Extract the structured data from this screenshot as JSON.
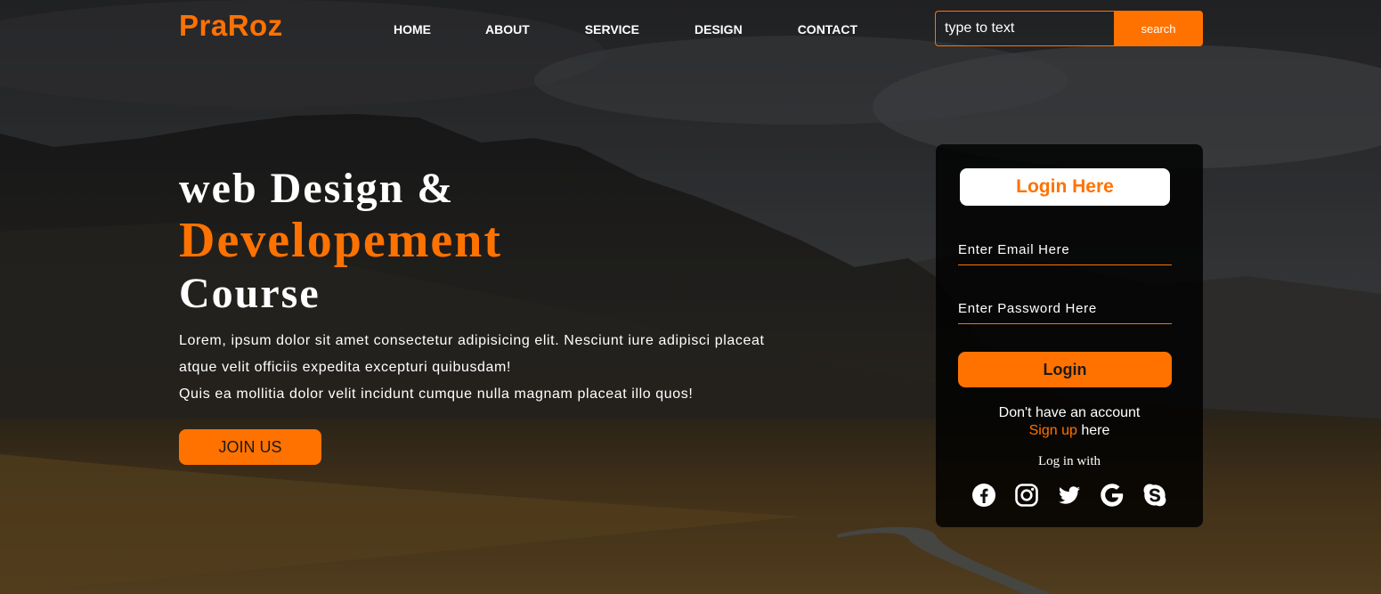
{
  "brand": {
    "name": "PraRoz",
    "accent_color": "#ff7200"
  },
  "nav": {
    "items": [
      {
        "label": "HOME"
      },
      {
        "label": "ABOUT"
      },
      {
        "label": "SERVICE"
      },
      {
        "label": "DESIGN"
      },
      {
        "label": "CONTACT"
      }
    ]
  },
  "search": {
    "placeholder": "type to text",
    "button_label": "search"
  },
  "hero": {
    "line1": "web Design &",
    "line2": "Developement",
    "line3": "Course",
    "desc1": "Lorem, ipsum dolor sit amet consectetur adipisicing elit. Nesciunt iure adipisci placeat",
    "desc2": "atque velit officiis expedita excepturi quibusdam!",
    "desc3": "Quis ea mollitia dolor velit incidunt cumque nulla magnam placeat illo quos!",
    "cta_label": "JOIN US"
  },
  "login": {
    "title": "Login Here",
    "email_placeholder": "Enter Email Here",
    "password_placeholder": "Enter Password Here",
    "button_label": "Login",
    "no_account_text": "Don't have an account",
    "signup_link": "Sign up",
    "signup_suffix": " here",
    "login_with": "Log in with",
    "socials": [
      {
        "icon": "facebook-icon"
      },
      {
        "icon": "instagram-icon"
      },
      {
        "icon": "twitter-icon"
      },
      {
        "icon": "google-icon"
      },
      {
        "icon": "skype-icon"
      }
    ]
  }
}
